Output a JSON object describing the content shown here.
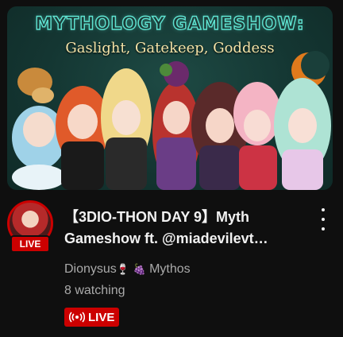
{
  "thumbnail": {
    "title": "MYTHOLOGY GAMESHOW:",
    "subtitle": "Gaslight, Gatekeep, Goddess"
  },
  "avatar": {
    "live_label": "LIVE"
  },
  "video": {
    "title_line1": "【3DIO-THON DAY 9】Myth",
    "title_line2": "Gameshow ft. @miadevilevt…"
  },
  "channel": {
    "name": "Dionysus",
    "emoji1": "🍷",
    "emoji2": "🍇",
    "group": "Mythos"
  },
  "meta": {
    "watching": "8 watching"
  },
  "badge": {
    "label": "LIVE"
  },
  "icons": {
    "more": "more-vert-icon",
    "live_broadcast": "broadcast-icon"
  },
  "colors": {
    "background": "#0f0f0f",
    "live_red": "#cc0000",
    "secondary_text": "#aaaaaa",
    "primary_text": "#f1f1f1"
  }
}
